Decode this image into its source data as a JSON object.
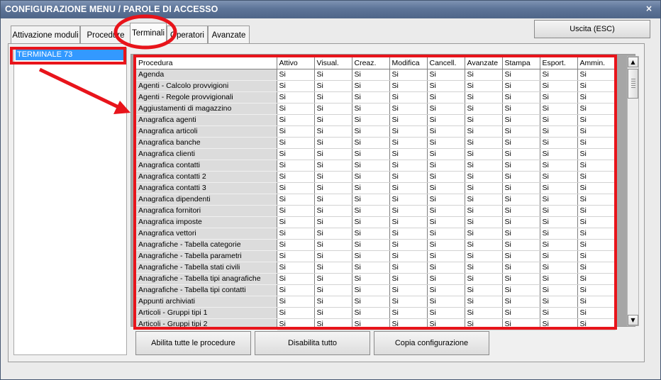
{
  "window": {
    "title": "CONFIGURAZIONE MENU / PAROLE DI ACCESSO",
    "close_glyph": "×"
  },
  "tabs": [
    {
      "label": "Attivazione moduli",
      "active": false
    },
    {
      "label": "Procedure",
      "active": false
    },
    {
      "label": "Terminali",
      "active": true
    },
    {
      "label": "Operatori",
      "active": false
    },
    {
      "label": "Avanzate",
      "active": false
    }
  ],
  "exit_button": {
    "label": "Uscita (ESC)"
  },
  "terminals": [
    {
      "label": "TERMINALE 73",
      "selected": true
    }
  ],
  "grid": {
    "columns": [
      "Procedura",
      "Attivo",
      "Visual.",
      "Creaz.",
      "Modifica",
      "Cancell.",
      "Avanzate",
      "Stampa",
      "Esport.",
      "Ammin."
    ],
    "rows": [
      {
        "procedure": "Agenda",
        "values": [
          "Si",
          "Si",
          "Si",
          "Si",
          "Si",
          "Si",
          "Si",
          "Si",
          "Si"
        ]
      },
      {
        "procedure": "Agenti - Calcolo provvigioni",
        "values": [
          "Si",
          "Si",
          "Si",
          "Si",
          "Si",
          "Si",
          "Si",
          "Si",
          "Si"
        ]
      },
      {
        "procedure": "Agenti - Regole provvigionali",
        "values": [
          "Si",
          "Si",
          "Si",
          "Si",
          "Si",
          "Si",
          "Si",
          "Si",
          "Si"
        ]
      },
      {
        "procedure": "Aggiustamenti di magazzino",
        "values": [
          "Si",
          "Si",
          "Si",
          "Si",
          "Si",
          "Si",
          "Si",
          "Si",
          "Si"
        ]
      },
      {
        "procedure": "Anagrafica agenti",
        "values": [
          "Si",
          "Si",
          "Si",
          "Si",
          "Si",
          "Si",
          "Si",
          "Si",
          "Si"
        ]
      },
      {
        "procedure": "Anagrafica articoli",
        "values": [
          "Si",
          "Si",
          "Si",
          "Si",
          "Si",
          "Si",
          "Si",
          "Si",
          "Si"
        ]
      },
      {
        "procedure": "Anagrafica banche",
        "values": [
          "Si",
          "Si",
          "Si",
          "Si",
          "Si",
          "Si",
          "Si",
          "Si",
          "Si"
        ]
      },
      {
        "procedure": "Anagrafica clienti",
        "values": [
          "Si",
          "Si",
          "Si",
          "Si",
          "Si",
          "Si",
          "Si",
          "Si",
          "Si"
        ]
      },
      {
        "procedure": "Anagrafica contatti",
        "values": [
          "Si",
          "Si",
          "Si",
          "Si",
          "Si",
          "Si",
          "Si",
          "Si",
          "Si"
        ]
      },
      {
        "procedure": "Anagrafica contatti 2",
        "values": [
          "Si",
          "Si",
          "Si",
          "Si",
          "Si",
          "Si",
          "Si",
          "Si",
          "Si"
        ]
      },
      {
        "procedure": "Anagrafica contatti 3",
        "values": [
          "Si",
          "Si",
          "Si",
          "Si",
          "Si",
          "Si",
          "Si",
          "Si",
          "Si"
        ]
      },
      {
        "procedure": "Anagrafica dipendenti",
        "values": [
          "Si",
          "Si",
          "Si",
          "Si",
          "Si",
          "Si",
          "Si",
          "Si",
          "Si"
        ]
      },
      {
        "procedure": "Anagrafica fornitori",
        "values": [
          "Si",
          "Si",
          "Si",
          "Si",
          "Si",
          "Si",
          "Si",
          "Si",
          "Si"
        ]
      },
      {
        "procedure": "Anagrafica imposte",
        "values": [
          "Si",
          "Si",
          "Si",
          "Si",
          "Si",
          "Si",
          "Si",
          "Si",
          "Si"
        ]
      },
      {
        "procedure": "Anagrafica vettori",
        "values": [
          "Si",
          "Si",
          "Si",
          "Si",
          "Si",
          "Si",
          "Si",
          "Si",
          "Si"
        ]
      },
      {
        "procedure": "Anagrafiche - Tabella categorie",
        "values": [
          "Si",
          "Si",
          "Si",
          "Si",
          "Si",
          "Si",
          "Si",
          "Si",
          "Si"
        ]
      },
      {
        "procedure": "Anagrafiche - Tabella parametri",
        "values": [
          "Si",
          "Si",
          "Si",
          "Si",
          "Si",
          "Si",
          "Si",
          "Si",
          "Si"
        ]
      },
      {
        "procedure": "Anagrafiche - Tabella stati civili",
        "values": [
          "Si",
          "Si",
          "Si",
          "Si",
          "Si",
          "Si",
          "Si",
          "Si",
          "Si"
        ]
      },
      {
        "procedure": "Anagrafiche - Tabella tipi anagrafiche",
        "values": [
          "Si",
          "Si",
          "Si",
          "Si",
          "Si",
          "Si",
          "Si",
          "Si",
          "Si"
        ]
      },
      {
        "procedure": "Anagrafiche - Tabella tipi contatti",
        "values": [
          "Si",
          "Si",
          "Si",
          "Si",
          "Si",
          "Si",
          "Si",
          "Si",
          "Si"
        ]
      },
      {
        "procedure": "Appunti archiviati",
        "values": [
          "Si",
          "Si",
          "Si",
          "Si",
          "Si",
          "Si",
          "Si",
          "Si",
          "Si"
        ]
      },
      {
        "procedure": "Articoli - Gruppi tipi 1",
        "values": [
          "Si",
          "Si",
          "Si",
          "Si",
          "Si",
          "Si",
          "Si",
          "Si",
          "Si"
        ]
      },
      {
        "procedure": "Articoli - Gruppi tipi 2",
        "values": [
          "Si",
          "Si",
          "Si",
          "Si",
          "Si",
          "Si",
          "Si",
          "Si",
          "Si"
        ]
      }
    ]
  },
  "scrollbar": {
    "up_glyph": "▲",
    "down_glyph": "▼"
  },
  "actions": {
    "enable_all": "Abilita tutte le procedure",
    "disable_all": "Disabilita tutto",
    "copy_config": "Copia configurazione"
  },
  "colors": {
    "annotation": "#e8141b",
    "selection": "#3399ff",
    "titlebar": "#5d7498"
  },
  "icons": {
    "close": "close-icon",
    "scroll_up": "arrow-up-icon",
    "scroll_down": "arrow-down-icon"
  }
}
